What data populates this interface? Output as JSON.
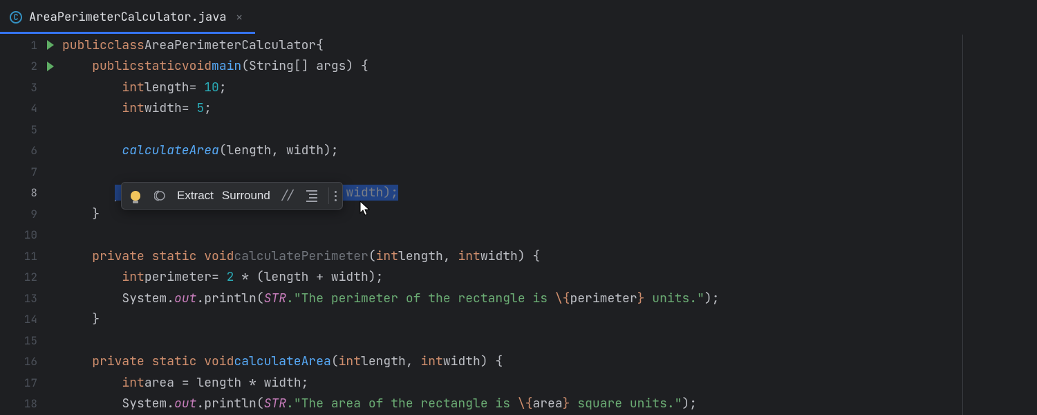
{
  "tab": {
    "icon_letter": "C",
    "title": "AreaPerimeterCalculator.java"
  },
  "gutter": {
    "run_lines": [
      1,
      2
    ],
    "lines": [
      1,
      2,
      3,
      4,
      5,
      6,
      7,
      8,
      9,
      10,
      11,
      12,
      13,
      14,
      15,
      16,
      17,
      18
    ],
    "current_line": 8
  },
  "code": {
    "class_name": "AreaPerimeterCalculator",
    "main_name": "main",
    "main_args": "(String[] args)",
    "length_decl": {
      "type": "int",
      "name": "length",
      "value": "10"
    },
    "width_decl": {
      "type": "int",
      "name": "width",
      "value": "5"
    },
    "calc_area_call": "calculateArea",
    "calc_area_args": "(length, width);",
    "commented_line": "// calculatePerimeter(length, width);",
    "perimeter_method": {
      "modifiers": "private static void",
      "name": "calculatePerimeter",
      "params_open": "(",
      "p1_type": "int",
      "p1_name": "length",
      "p2_type": "int",
      "p2_name": "width",
      "params_close": ")",
      "body_var_type": "int",
      "body_var_name": "perimeter",
      "body_expr_num": "2",
      "body_expr_rest": " * (length + width);",
      "sysout_pre": "System.",
      "sysout_out": "out",
      "sysout_println": ".println(",
      "str_template_prefix": "STR",
      "str_open": ".\"",
      "str_text1": "The perimeter of the rectangle is ",
      "str_esc1": "\\{",
      "str_var1": "perimeter",
      "str_esc2": "}",
      "str_text2": " units.",
      "str_close": "\");"
    },
    "area_method": {
      "modifiers": "private static void",
      "name": "calculateArea",
      "params_open": "(",
      "p1_type": "int",
      "p1_name": "length",
      "p2_type": "int",
      "p2_name": "width",
      "params_close": ")",
      "body_var_type": "int",
      "body_var_name": "area",
      "body_expr": " = length * width;",
      "sysout_pre": "System.",
      "sysout_out": "out",
      "sysout_println": ".println(",
      "str_template_prefix": "STR",
      "str_open": ".\"",
      "str_text1": "The area of the rectangle is ",
      "str_esc1": "\\{",
      "str_var1": "area",
      "str_esc2": "}",
      "str_text2": " square units.",
      "str_close": "\");"
    },
    "kw": {
      "public": "public",
      "class": "class",
      "static": "static",
      "void": "void",
      "private": "private",
      "int": "int"
    }
  },
  "toolbar": {
    "extract": "Extract",
    "surround": "Surround"
  }
}
